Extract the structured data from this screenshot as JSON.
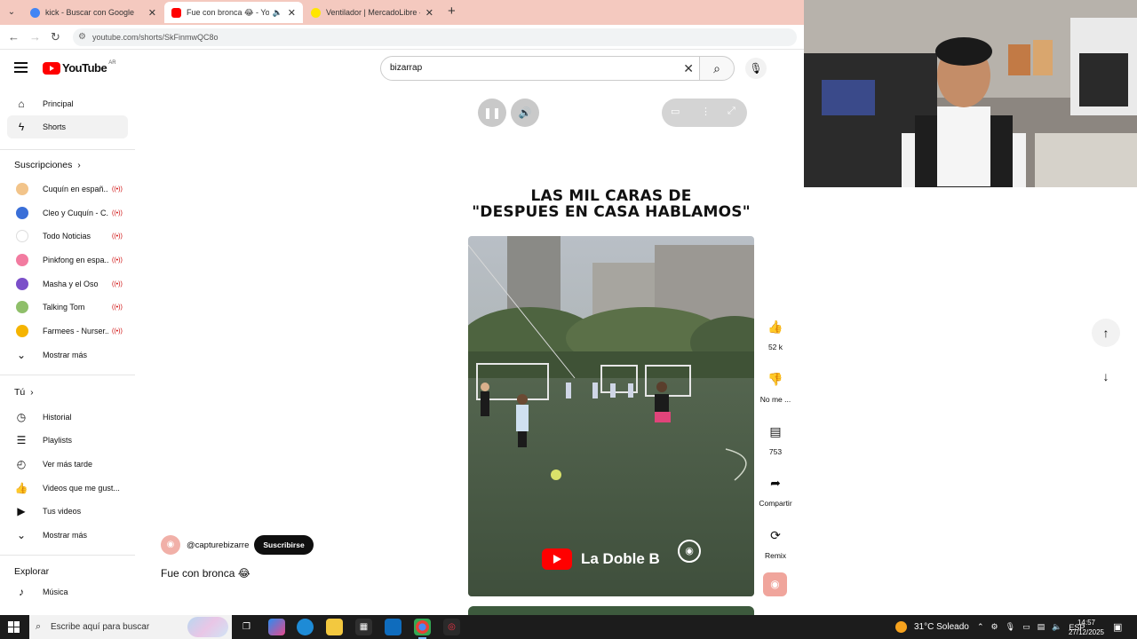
{
  "browser": {
    "tabs": [
      {
        "title": "kick - Buscar con Google",
        "favicon_color": "#4285f4",
        "active": false
      },
      {
        "title": "Fue con bronca 😂 - YouTu",
        "favicon_color": "#ff0000",
        "active": true
      },
      {
        "title": "Ventilador | MercadoLibre 😂",
        "favicon_color": "#ffe600",
        "active": false
      }
    ],
    "new_tab": "+",
    "url": "youtube.com/shorts/SkFinmwQC8o"
  },
  "header": {
    "logo_text": "YouTube",
    "region": "AR",
    "search_value": "bizarrap"
  },
  "sidebar": {
    "main": [
      {
        "icon": "home-icon",
        "label": "Principal",
        "active": false
      },
      {
        "icon": "shorts-icon",
        "label": "Shorts",
        "active": true
      }
    ],
    "subscriptions_heading": "Suscripciones",
    "subscriptions": [
      {
        "label": "Cuquín en españ...",
        "avatar_color": "#f2c48a"
      },
      {
        "label": "Cleo y Cuquín - C...",
        "avatar_color": "#3a6fd8"
      },
      {
        "label": "Todo Noticias",
        "avatar_color": "#ffffff"
      },
      {
        "label": "Pinkfong en espa...",
        "avatar_color": "#f27ba0"
      },
      {
        "label": "Masha y el Oso",
        "avatar_color": "#7b4fc9"
      },
      {
        "label": "Talking Tom",
        "avatar_color": "#8fbf6a"
      },
      {
        "label": "Farmees - Nurser...",
        "avatar_color": "#f5b400"
      }
    ],
    "subscriptions_more": "Mostrar más",
    "you_heading": "Tú",
    "you": [
      {
        "icon": "history-icon",
        "label": "Historial"
      },
      {
        "icon": "playlists-icon",
        "label": "Playlists"
      },
      {
        "icon": "watch-later-icon",
        "label": "Ver más tarde"
      },
      {
        "icon": "liked-icon",
        "label": "Videos que me gust..."
      },
      {
        "icon": "your-videos-icon",
        "label": "Tus videos"
      }
    ],
    "you_more": "Mostrar más",
    "explore_heading": "Explorar",
    "explore": [
      {
        "icon": "music-icon",
        "label": "Música"
      }
    ]
  },
  "short": {
    "overlay_title": "LAS MIL CARAS DE\n\"DESPUES EN CASA HABLAMOS\"",
    "watermark": "La Doble B",
    "channel_handle": "@capturebizarre",
    "subscribe_label": "Suscribirse",
    "caption": "Fue con bronca 😂"
  },
  "actions": {
    "likes": "52 k",
    "dislike": "No me ...",
    "comments": "753",
    "share": "Compartir",
    "remix": "Remix"
  },
  "taskbar": {
    "search_placeholder": "Escribe aquí para buscar",
    "temperature": "31°C",
    "weather": "Soleado",
    "lang": "ESP",
    "time": "14:57",
    "date": "27/12/2025"
  }
}
